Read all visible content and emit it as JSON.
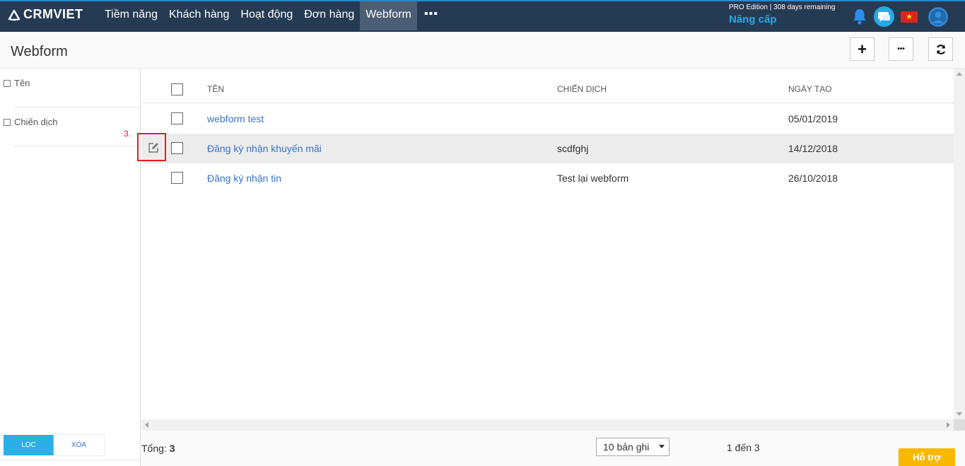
{
  "app": {
    "brand": "CRMVIET"
  },
  "nav": {
    "items": [
      "Tiềm năng",
      "Khách hàng",
      "Hoạt động",
      "Đơn hàng",
      "Webform"
    ],
    "active": "Webform",
    "more_label": "▪▪▪"
  },
  "account": {
    "edition_text": "PRO Edition | 308 days remaining",
    "upgrade_label": "Nâng cấp"
  },
  "page": {
    "title": "Webform"
  },
  "header_buttons": {
    "add_label": "+",
    "more_label": "•••"
  },
  "filter": {
    "items": [
      "Tên",
      "Chiến dịch"
    ],
    "apply_label": "LỌC",
    "clear_label": "XÓA"
  },
  "table": {
    "columns": [
      "TÊN",
      "CHIẾN DỊCH",
      "NGÀY TẠO"
    ],
    "rows": [
      {
        "name": "webform test",
        "campaign": "",
        "created": "05/01/2019"
      },
      {
        "name": "Đăng ký nhận khuyến mãi",
        "campaign": "scdfghj",
        "created": "14/12/2018"
      },
      {
        "name": "Đăng ký nhận tin",
        "campaign": "Test lại webform",
        "created": "26/10/2018"
      }
    ]
  },
  "annotation": {
    "step_label": "3."
  },
  "footer": {
    "total_label": "Tổng:",
    "total_value": "3",
    "per_page": "10 bản ghi",
    "range_text": "1 đến 3",
    "support_label": "Hỗ trợ"
  },
  "colors": {
    "nav_bg": "#253b53",
    "accent": "#29a8e8",
    "link": "#3a72c6",
    "highlight": "#e41e1e",
    "support": "#f8b900"
  }
}
